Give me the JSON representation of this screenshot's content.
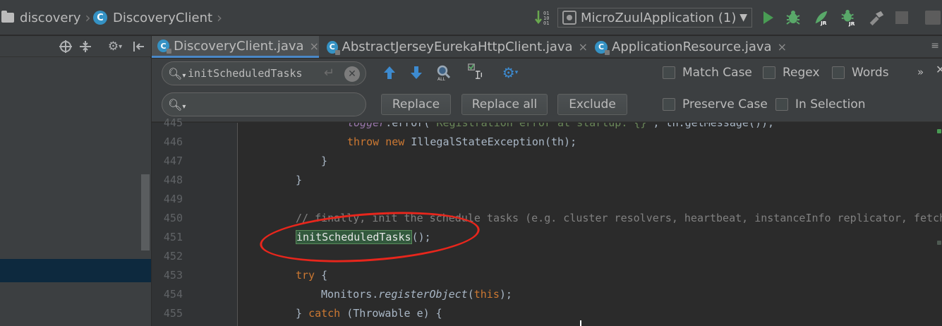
{
  "breadcrumb": {
    "project": "discovery",
    "class_name": "DiscoveryClient"
  },
  "run_config": {
    "name": "MicroZuulApplication (1)"
  },
  "tabs": [
    {
      "label": "DiscoveryClient.java",
      "close": "×"
    },
    {
      "label": "AbstractJerseyEurekaHttpClient.java",
      "close": "×"
    },
    {
      "label": "ApplicationResource.java",
      "close": "×"
    }
  ],
  "find": {
    "search_value": "initScheduledTasks",
    "replace_value": "",
    "replace_button": "Replace",
    "replace_all_button": "Replace all",
    "exclude_button": "Exclude",
    "match_case": "Match Case",
    "regex": "Regex",
    "words": "Words",
    "preserve_case": "Preserve Case",
    "in_selection": "In Selection",
    "more": "»"
  },
  "code": {
    "line_numbers": [
      "445",
      "446",
      "447",
      "448",
      "449",
      "450",
      "451",
      "452",
      "453",
      "454",
      "455"
    ],
    "l445_logger": "logger",
    "l445_rest": ".error(",
    "l445_str": "\"Registration error at startup: {}\"",
    "l445_tail": ", th.getMessage());",
    "l446_throw": "throw",
    "l446_new": "new",
    "l446_rest": " IllegalStateException(th);",
    "l447": "}",
    "l448": "}",
    "l450": "// finally, init the schedule tasks (e.g. cluster resolvers, heartbeat, instanceInfo replicator, fetch",
    "l451_match": "initScheduledTasks",
    "l451_rest": "();",
    "l453_try": "try",
    "l453_rest": " {",
    "l454_obj": "Monitors.",
    "l454_method": "registerObject",
    "l454_open": "(",
    "l454_this": "this",
    "l454_close": ");",
    "l455_open": "} ",
    "l455_catch": "catch",
    "l455_rest": " (Throwable e) {"
  },
  "colors": {
    "annotation": "#e8261c",
    "match_highlight": "#32593d",
    "keyword": "#cc7832",
    "run_green": "#499c54"
  },
  "icons": {
    "run": "run-icon",
    "debug": "debug-icon",
    "jrebel_run": "jrebel-run-icon",
    "jrebel_debug": "jrebel-debug-icon",
    "build": "build-icon",
    "stop": "stop-icon"
  }
}
